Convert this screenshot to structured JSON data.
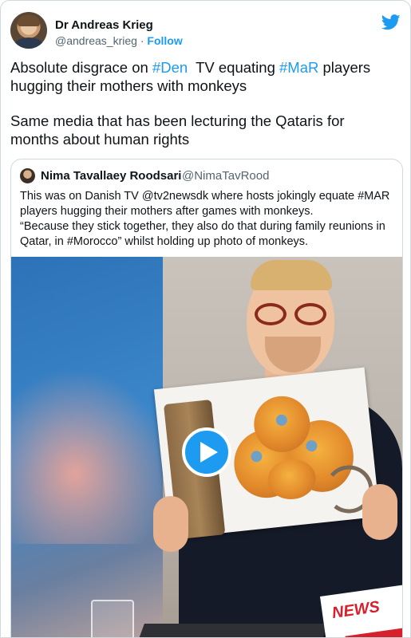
{
  "author": {
    "name": "Dr Andreas Krieg",
    "handle": "@andreas_krieg",
    "separator": "·",
    "follow_label": "Follow"
  },
  "tweet": {
    "line1_a": "Absolute disgrace on ",
    "line1_tag1": "#Den",
    "line1_b": "  TV equating ",
    "line1_tag2": "#MaR",
    "line1_c": "  players hugging their mothers with monkeys",
    "para2": "Same media that has been lecturing the Qataris for months about human rights"
  },
  "quote": {
    "name": "Nima Tavallaey Roodsari",
    "handle": "@NimaTavRood",
    "lines": [
      "This was on Danish TV @tv2newsdk where hosts jokingly equate #MAR",
      "players hugging their mothers after games with monkeys.",
      "“Because they stick together, they also do that during family reunions in",
      "Qatar, in #Morocco” whilst holding up photo of monkeys."
    ]
  },
  "media": {
    "overlay_text": "NEWS",
    "play_icon": "play-icon"
  },
  "icons": {
    "brand": "twitter-bird-icon"
  },
  "colors": {
    "accent": "#1d9bf0",
    "text": "#0f1419",
    "muted": "#536471",
    "border": "#cfd9de",
    "news_red": "#d6202b"
  }
}
